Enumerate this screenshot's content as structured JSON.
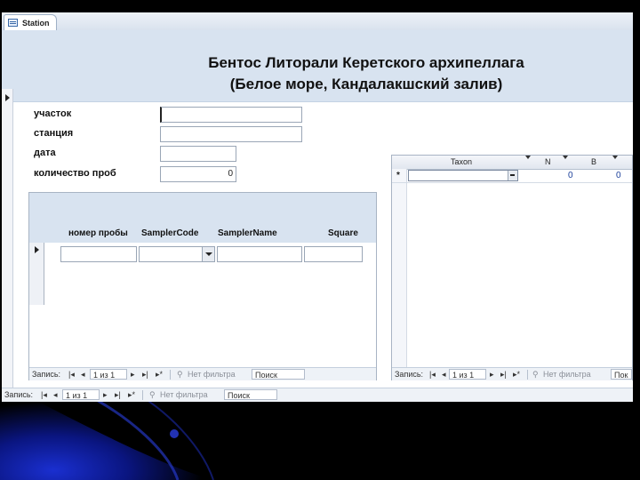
{
  "tab": {
    "label": "Station",
    "icon": "form-icon"
  },
  "title": {
    "line1": "Бентос Литорали Керетского архипеллага",
    "line2": "(Белое море, Кандалакшский залив)"
  },
  "fields": [
    {
      "label": "участок",
      "value": ""
    },
    {
      "label": "станция",
      "value": ""
    },
    {
      "label": "дата",
      "value": ""
    },
    {
      "label": "количество проб",
      "value": "0"
    }
  ],
  "subform": {
    "columns": [
      "номер пробы",
      "SamplerCode",
      "SamplerName",
      "Square"
    ],
    "nav": {
      "label": "Запись:",
      "pos": "1 из 1",
      "filter": "Нет фильтра",
      "search": "Поиск"
    }
  },
  "datasheet": {
    "columns": [
      "Taxon",
      "N",
      "B"
    ],
    "new_row": {
      "marker": "*",
      "n": "0",
      "b": "0"
    },
    "nav": {
      "label": "Запись:",
      "pos": "1 из 1",
      "filter": "Нет фильтра",
      "search": "Пок"
    }
  },
  "main_nav": {
    "label": "Запись:",
    "pos": "1 из 1",
    "filter": "Нет фильтра",
    "search": "Поиск"
  },
  "nav_icons": {
    "first": "|◂",
    "prev": "◂",
    "next": "▸",
    "last": "▸|",
    "new": "▸*",
    "filter": "⚲"
  },
  "colors": {
    "header_band": "#d8e3f0",
    "border": "#9aa6b6",
    "slide_bg": "#000000",
    "accent_blue": "#1a2fd0"
  }
}
